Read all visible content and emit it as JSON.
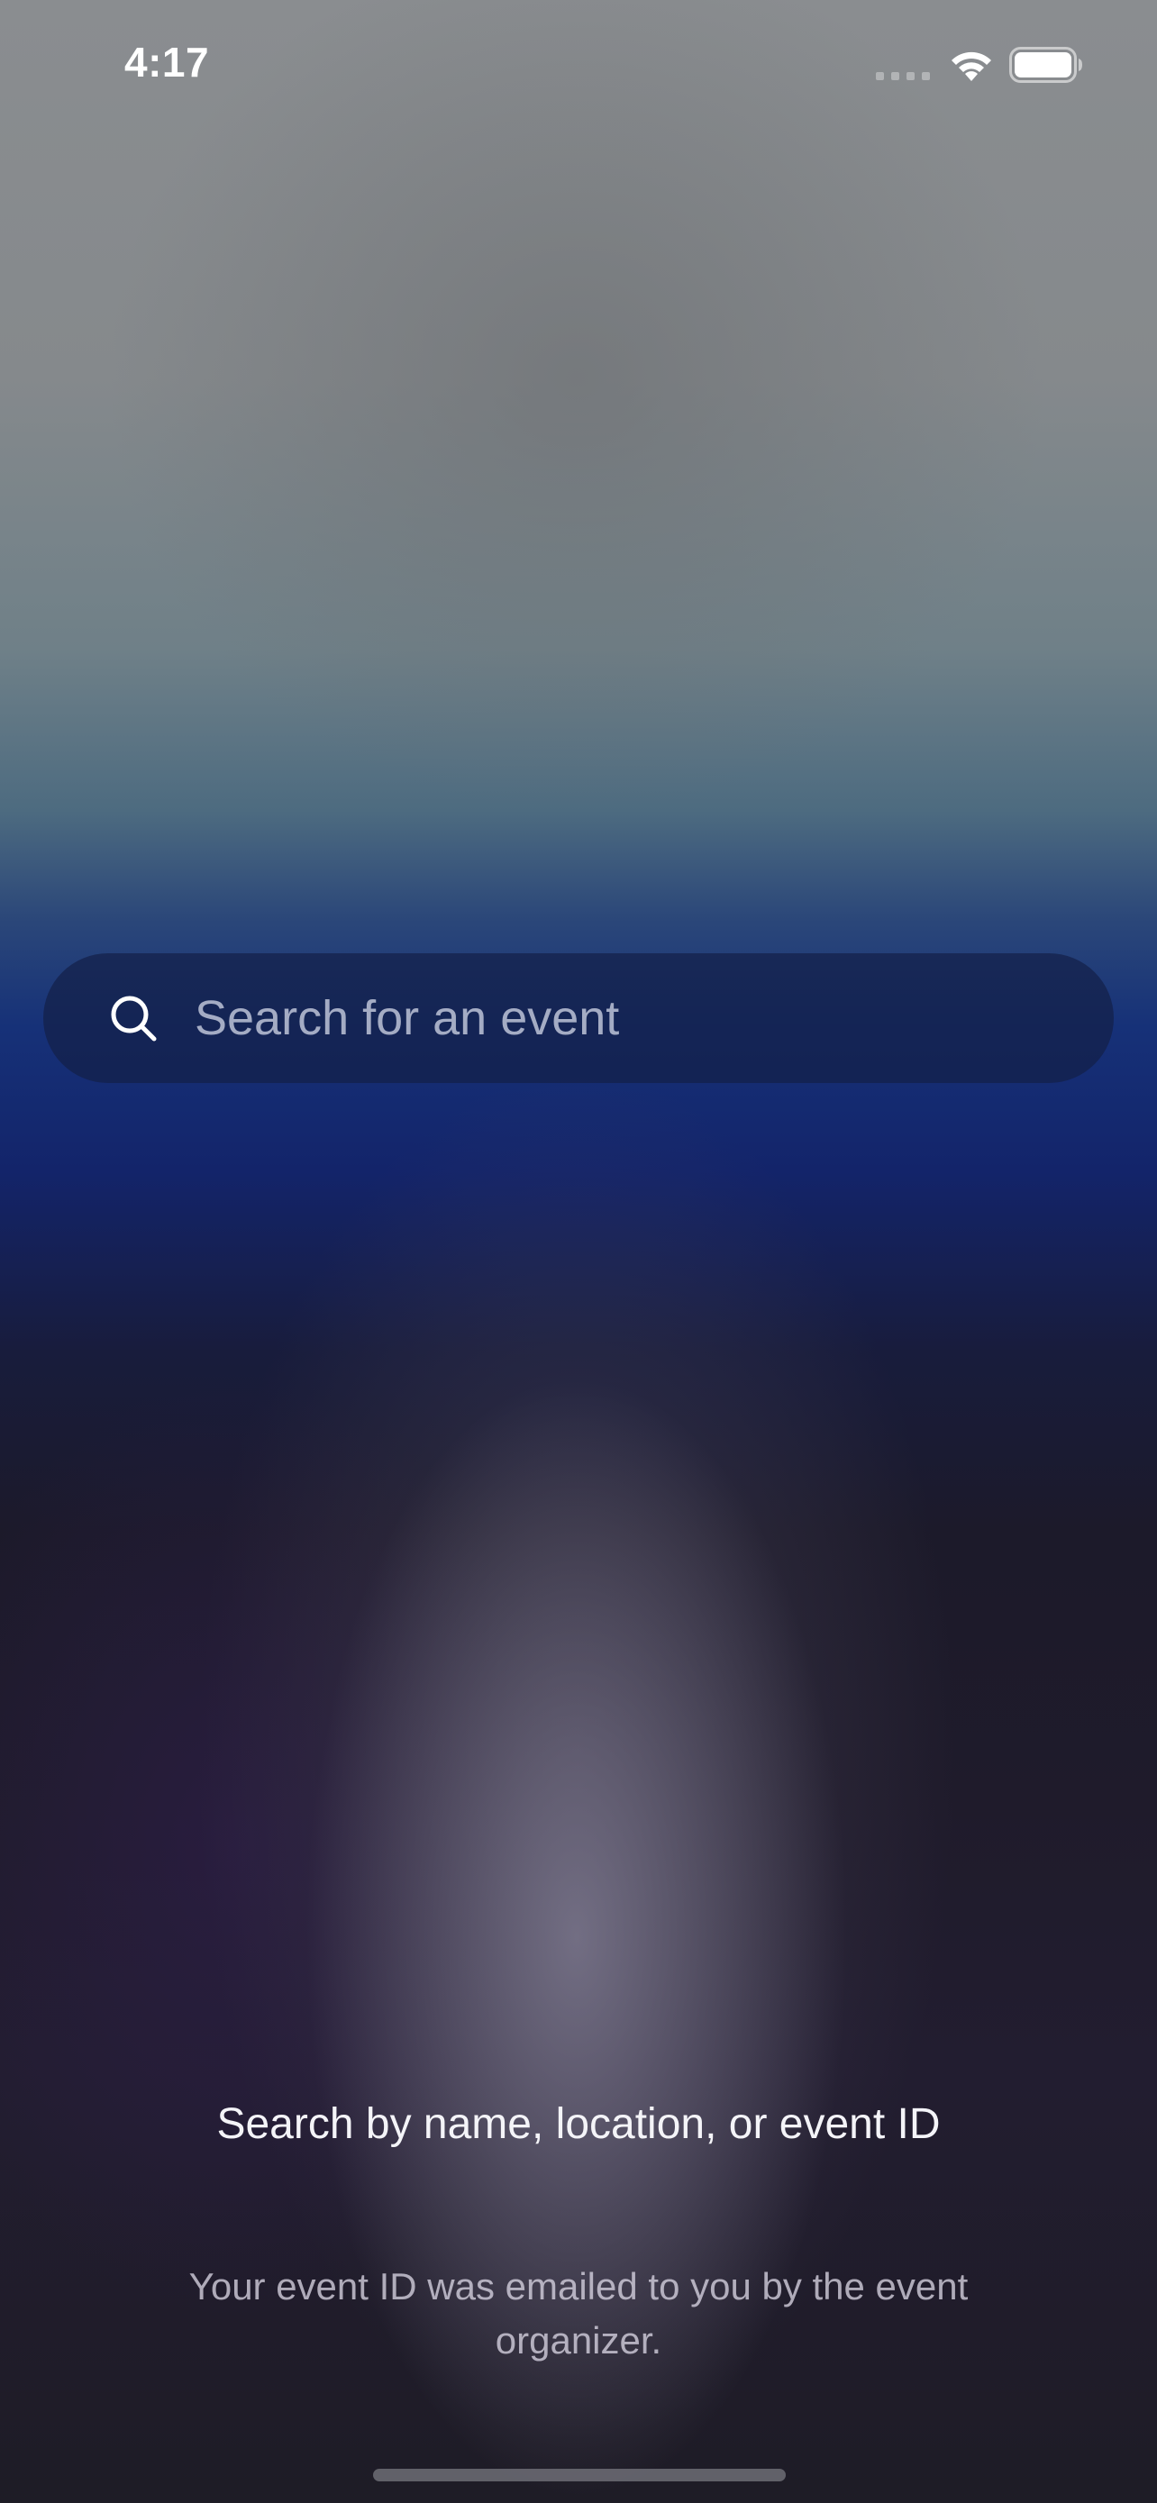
{
  "status_bar": {
    "time": "4:17",
    "icons": [
      "cellular-signal-icon",
      "wifi-icon",
      "battery-icon"
    ]
  },
  "search": {
    "placeholder": "Search for an event",
    "icon": "search-icon"
  },
  "hint": {
    "title": "Search by name, location, or event ID",
    "subtitle": "Your event ID was emailed to you by the event organizer."
  },
  "colors": {
    "top_gray": "#8a8d90",
    "mid_blue": "#163178",
    "bottom_dark": "#1e1c26",
    "search_bg": "#142048"
  }
}
